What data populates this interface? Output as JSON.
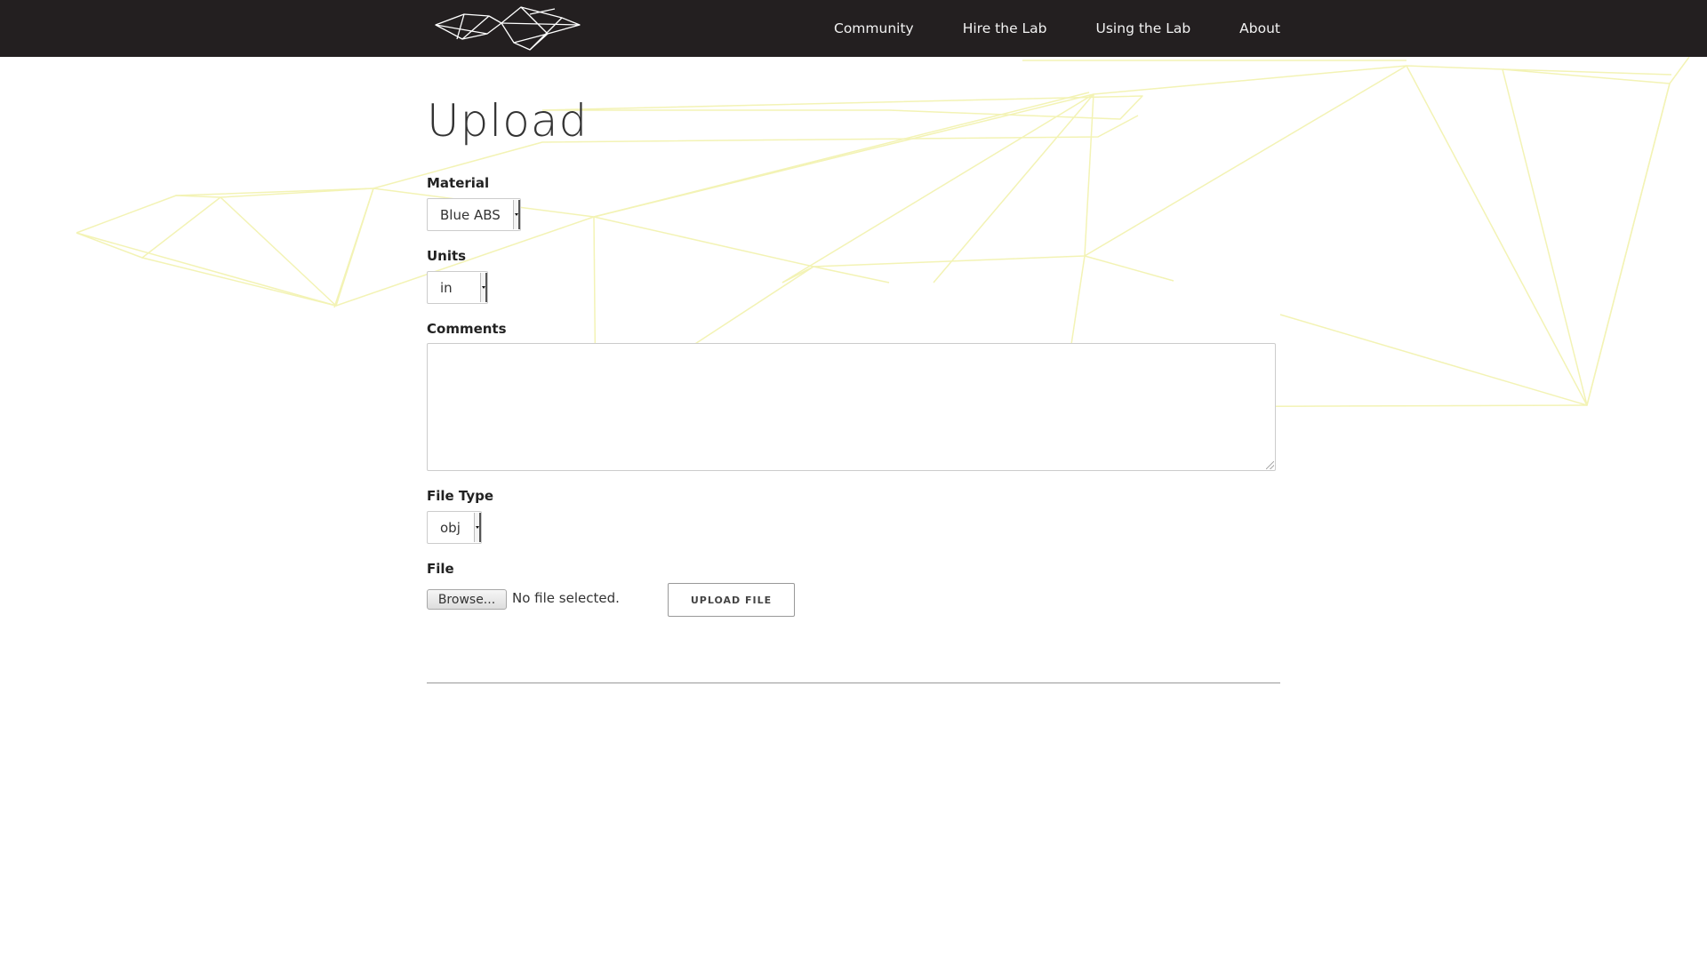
{
  "nav": {
    "logo_icon": "geometric-wireframe-logo",
    "links": [
      "Community",
      "Hire the Lab",
      "Using the Lab",
      "About"
    ]
  },
  "page": {
    "title": "Upload"
  },
  "form": {
    "material": {
      "label": "Material",
      "value": "Blue ABS"
    },
    "units": {
      "label": "Units",
      "value": "in"
    },
    "comments": {
      "label": "Comments",
      "value": ""
    },
    "file_type": {
      "label": "File Type",
      "value": "obj"
    },
    "file": {
      "label": "File",
      "browse_label": "Browse...",
      "status": "No file selected."
    },
    "upload_label": "UPLOAD FILE"
  },
  "colors": {
    "nav_background": "#231f20",
    "nav_text": "#f2f2f2",
    "background_lines": "#f3f3b5"
  }
}
